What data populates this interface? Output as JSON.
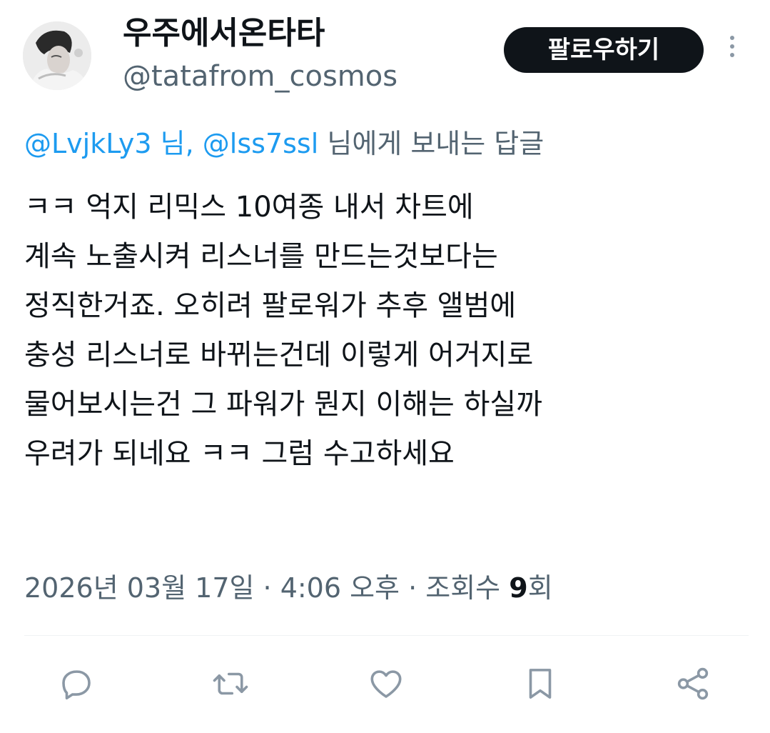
{
  "author": {
    "display_name": "우주에서온타타",
    "handle": "@tatafrom_cosmos"
  },
  "follow_button_label": "팔로우하기",
  "reply_context": {
    "mention_1": "@LvjkLy3 님,",
    "mention_2": "@lss7ssl",
    "suffix": "님에게 보내는 답글"
  },
  "tweet_lines": [
    "ㅋㅋ 억지 리믹스 10여종 내서 차트에",
    "계속 노출시켜 리스너를 만드는것보다는",
    "정직한거죠. 오히려 팔로워가 추후 앨범에",
    "충성 리스너로 바뀌는건데 이렇게 어거지로",
    "물어보시는건 그 파워가 뭔지 이해는 하실까",
    "우려가 되네요 ㅋㅋ 그럼 수고하세요"
  ],
  "meta": {
    "timestamp": "2026년 03월 17일 · 4:06 오후 · 조회수 ",
    "views_count": "9",
    "views_unit": "회"
  },
  "actions": [
    "reply-icon",
    "retweet-icon",
    "like-icon",
    "bookmark-icon",
    "share-icon"
  ],
  "colors": {
    "accent": "#1d9bf0",
    "text_primary": "#0f1419",
    "text_secondary": "#536471",
    "icon": "#8b98a5",
    "button_bg": "#0f1419"
  }
}
